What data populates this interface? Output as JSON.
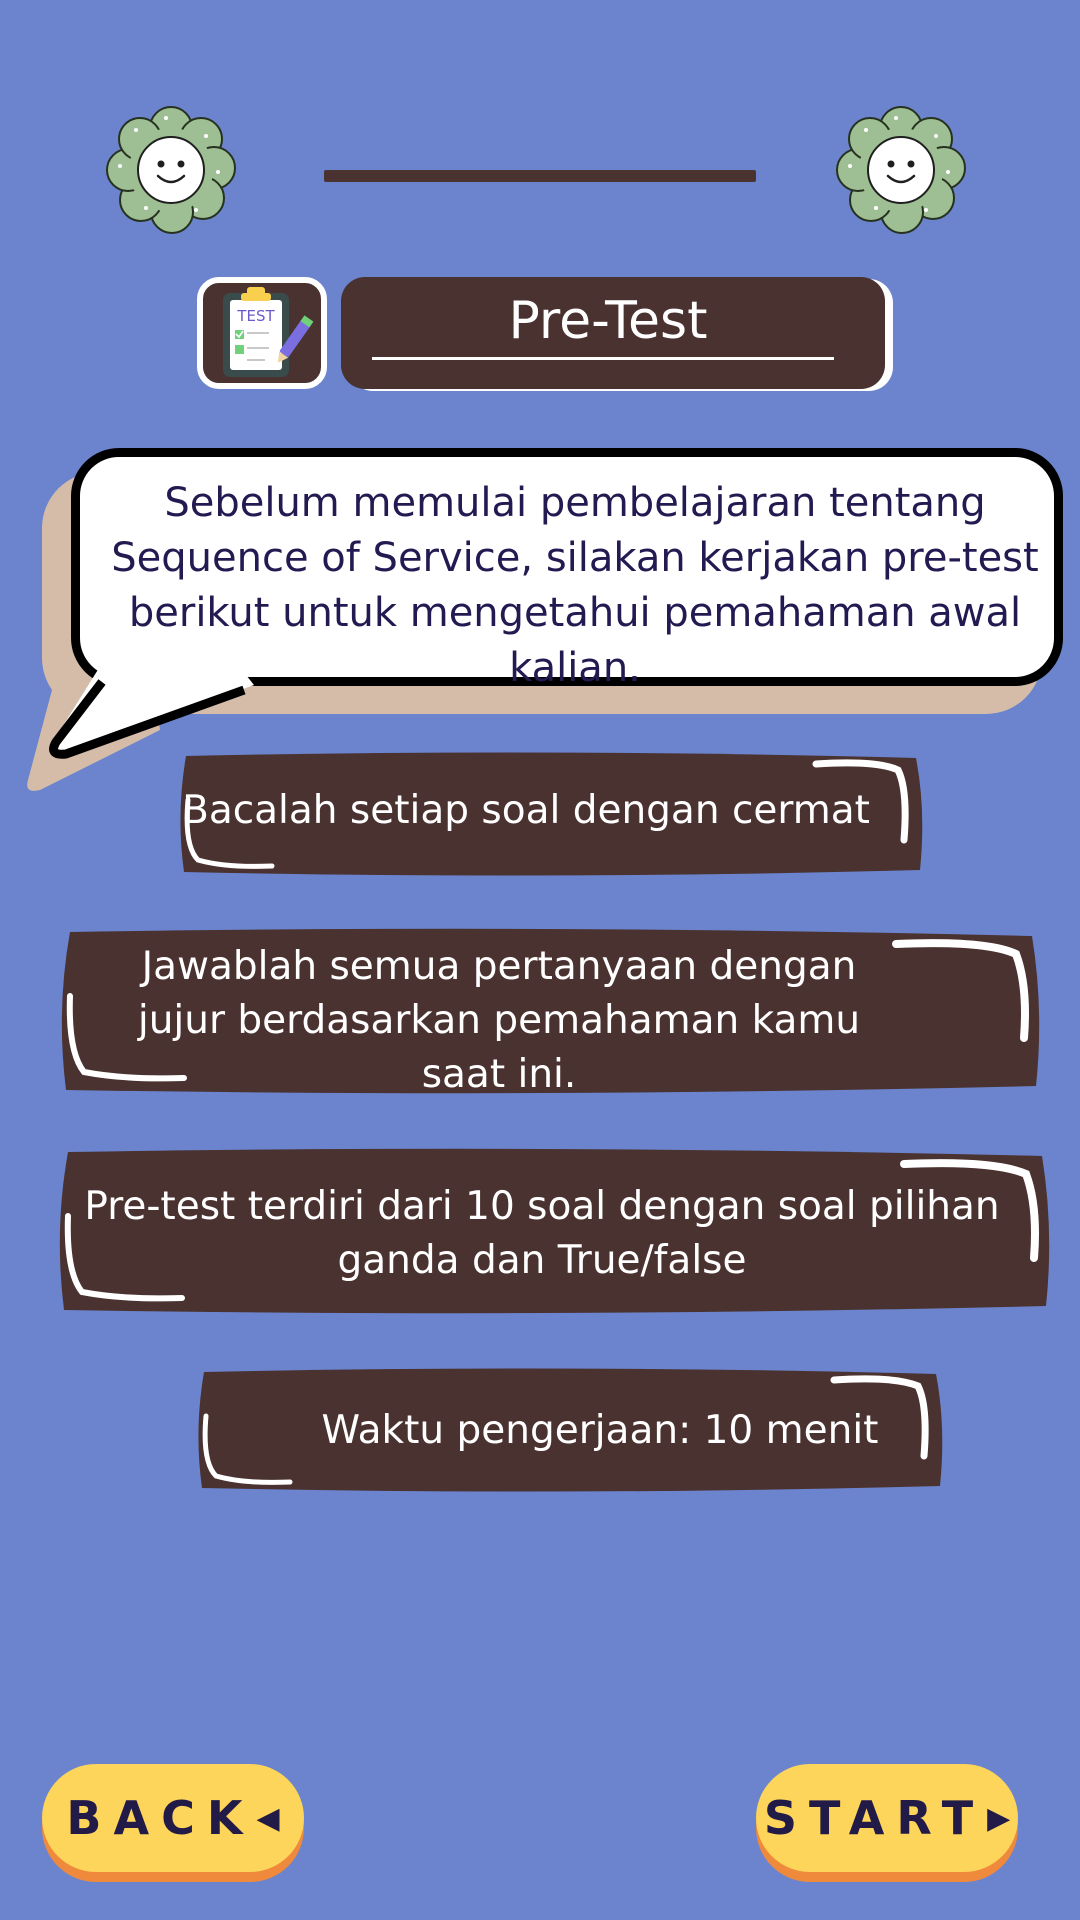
{
  "header": {
    "title": "Pre-Test",
    "icon_label": "TEST"
  },
  "intro": {
    "text_line1": "Sebelum memulai pembelajaran tentang",
    "text_line2": "Sequence of Service, silakan kerjakan pre-test",
    "text_line3": "berikut untuk mengetahui pemahaman awal kalian."
  },
  "instructions": [
    {
      "lines": [
        "Bacalah setiap soal dengan cermat"
      ]
    },
    {
      "lines": [
        "Jawablah semua pertanyaan dengan",
        "jujur berdasarkan pemahaman kamu",
        "saat ini."
      ]
    },
    {
      "lines": [
        "Pre-test terdiri dari 10 soal dengan soal pilihan",
        "ganda dan True/false"
      ]
    },
    {
      "lines": [
        "Waktu pengerjaan: 10 menit"
      ]
    }
  ],
  "buttons": {
    "back_label": "BACK",
    "start_label": "START"
  },
  "colors": {
    "background": "#6b84cd",
    "card": "#4a3230",
    "button": "#fdd55a",
    "button_shadow": "#ef8a3c"
  },
  "icons": {
    "flower": "smiling-flower-icon",
    "test": "test-clipboard-icon"
  }
}
